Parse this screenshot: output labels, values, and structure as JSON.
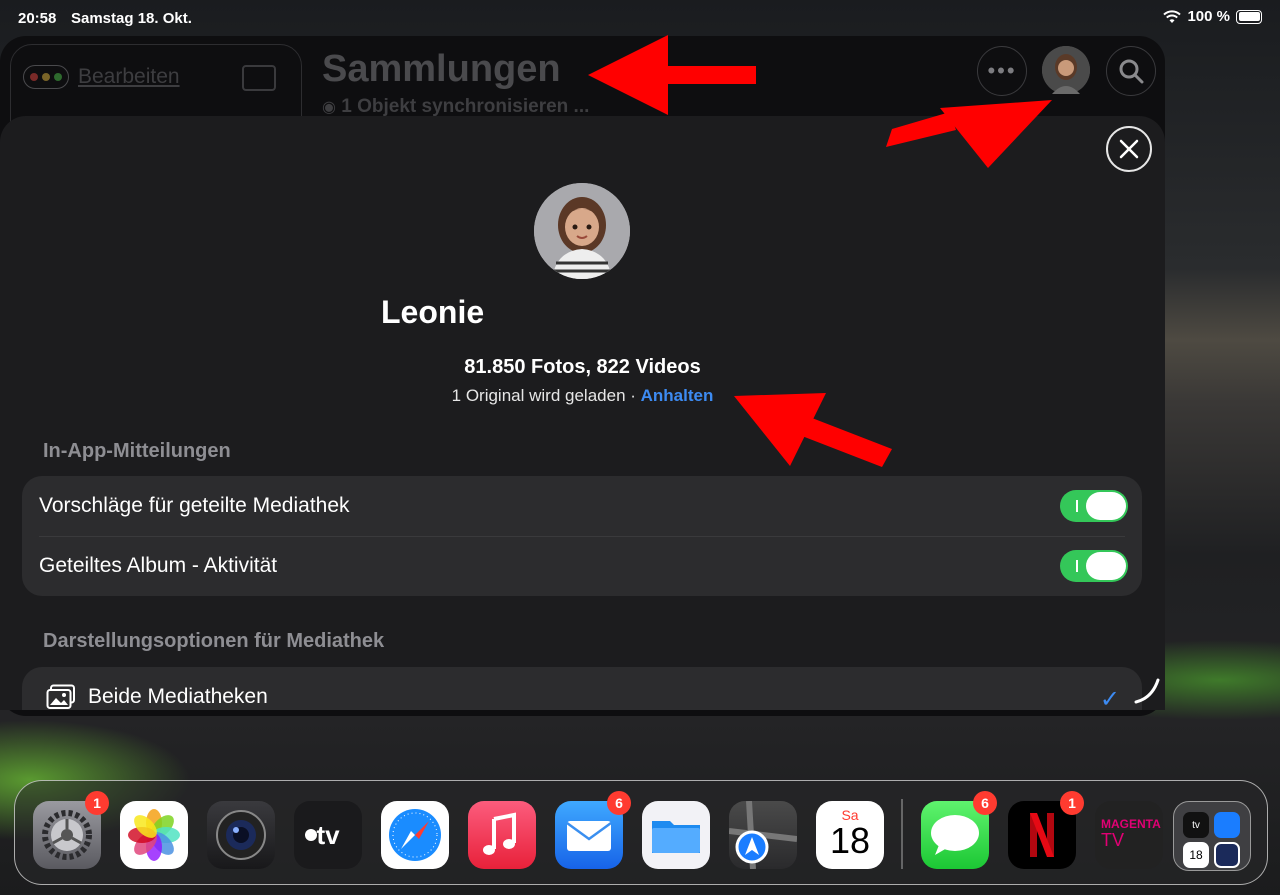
{
  "status": {
    "time": "20:58",
    "date": "Samstag 18. Okt.",
    "battery": "100 %"
  },
  "app": {
    "edit_label": "Bearbeiten",
    "title": "Sammlungen",
    "subtitle": "1 Objekt synchronisieren ...",
    "more_icon": "ellipsis-icon",
    "search_icon": "search-icon"
  },
  "profile": {
    "name": "Leonie",
    "stats": "81.850 Fotos, 822 Videos",
    "sync_status": "1 Original wird geladen · ",
    "pause_label": "Anhalten"
  },
  "notifications": {
    "header": "In-App-Mitteilungen",
    "items": [
      {
        "label": "Vorschläge für geteilte Mediathek",
        "enabled": true
      },
      {
        "label": "Geteiltes Album - Aktivität",
        "enabled": true
      }
    ]
  },
  "library_options": {
    "header": "Darstellungsoptionen für Mediathek",
    "items": [
      {
        "label": "Beide Mediatheken",
        "selected": true
      }
    ]
  },
  "dock": {
    "apps": [
      {
        "name": "Einstellungen",
        "badge": "1"
      },
      {
        "name": "Fotos",
        "badge": ""
      },
      {
        "name": "Kamera",
        "badge": ""
      },
      {
        "name": "TV",
        "badge": ""
      },
      {
        "name": "Safari",
        "badge": ""
      },
      {
        "name": "Musik",
        "badge": ""
      },
      {
        "name": "Mail",
        "badge": "6"
      },
      {
        "name": "Dateien",
        "badge": ""
      },
      {
        "name": "Karten",
        "badge": ""
      },
      {
        "name": "Kalender",
        "badge": "",
        "day_label": "Sa",
        "day_number": "18"
      },
      {
        "name": "Nachrichten",
        "badge": "6"
      },
      {
        "name": "Netflix",
        "badge": "1"
      },
      {
        "name": "MagentaTV",
        "badge": "",
        "text_top": "MAGENTA",
        "text_bottom": "TV"
      }
    ],
    "library_folder": {
      "tv_text": "tv",
      "day": "18"
    }
  },
  "colors": {
    "accent": "#3d8bf2",
    "toggle_on": "#34c759",
    "badge": "#ff3b30",
    "annotation_arrow": "#ff0000"
  }
}
